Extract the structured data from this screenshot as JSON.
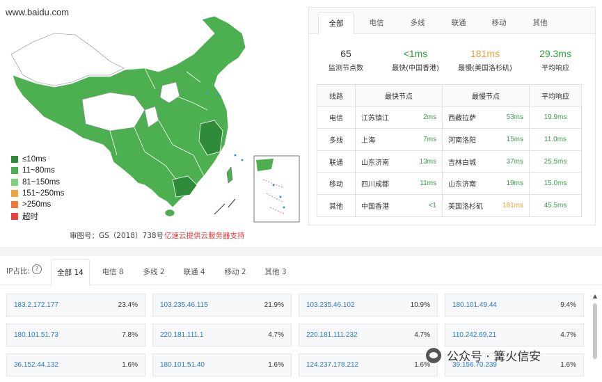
{
  "map": {
    "domain": "www.baidu.com",
    "legend": [
      {
        "label": "≤10ms",
        "color": "#2e8b3a"
      },
      {
        "label": "11~80ms",
        "color": "#4caf50"
      },
      {
        "label": "81~150ms",
        "color": "#7ed07a"
      },
      {
        "label": "151~250ms",
        "color": "#f2a23c"
      },
      {
        "label": ">250ms",
        "color": "#f07a3a"
      },
      {
        "label": "超时",
        "color": "#e84343"
      }
    ],
    "caption": "审图号：GS（2018）738号",
    "credit": "亿速云提供云服务器支持"
  },
  "panel": {
    "tabs": [
      "全部",
      "电信",
      "多线",
      "联通",
      "移动",
      "其他"
    ],
    "active_tab": "全部",
    "stats": [
      {
        "value": "65",
        "label": "监测节点数",
        "color": "#333333"
      },
      {
        "value": "<1ms",
        "label": "最快(中国香港)",
        "color": "#2e9e3e"
      },
      {
        "value": "181ms",
        "label": "最慢(美国洛杉矶)",
        "color": "#f0a030"
      },
      {
        "value": "29.3ms",
        "label": "平均响应",
        "color": "#2e9e3e"
      }
    ],
    "table": {
      "headers": [
        "线路",
        "最快节点",
        "最慢节点",
        "平均响应"
      ],
      "rows": [
        {
          "line": "电信",
          "fast_node": "江苏镇江",
          "fast_ms": "2ms",
          "slow_node": "西藏拉萨",
          "slow_ms": "53ms",
          "avg": "19.9ms"
        },
        {
          "line": "多线",
          "fast_node": "上海",
          "fast_ms": "7ms",
          "slow_node": "河南洛阳",
          "slow_ms": "15ms",
          "avg": "11.0ms"
        },
        {
          "line": "联通",
          "fast_node": "山东济南",
          "fast_ms": "13ms",
          "slow_node": "吉林白城",
          "slow_ms": "37ms",
          "avg": "25.5ms"
        },
        {
          "line": "移动",
          "fast_node": "四川成都",
          "fast_ms": "11ms",
          "slow_node": "山东济南",
          "slow_ms": "19ms",
          "avg": "15.0ms"
        },
        {
          "line": "其他",
          "fast_node": "中国香港",
          "fast_ms": "<1",
          "slow_node": "美国洛杉矶",
          "slow_ms": "181ms",
          "avg": "45.5ms"
        }
      ]
    }
  },
  "ip": {
    "label": "IP占比:",
    "help_icon": "question-circle-icon",
    "tabs": [
      "全部 14",
      "电信 8",
      "多线 2",
      "联通 4",
      "移动 2",
      "其他 3"
    ],
    "active_tab": "全部 14",
    "cards": [
      {
        "ip": "183.2.172.177",
        "pct": "23.4%"
      },
      {
        "ip": "103.235.46.115",
        "pct": "21.9%"
      },
      {
        "ip": "103.235.46.102",
        "pct": "10.9%"
      },
      {
        "ip": "180.101.49.44",
        "pct": "9.4%"
      },
      {
        "ip": "180.101.51.73",
        "pct": "7.8%"
      },
      {
        "ip": "220.181.111.1",
        "pct": "4.7%"
      },
      {
        "ip": "220.181.111.232",
        "pct": "4.7%"
      },
      {
        "ip": "110.242.69.21",
        "pct": "4.7%"
      },
      {
        "ip": "36.152.44.132",
        "pct": "1.6%"
      },
      {
        "ip": "180.101.51.40",
        "pct": "1.6%"
      },
      {
        "ip": "124.237.178.212",
        "pct": "1.6%"
      },
      {
        "ip": "39.156.70.239",
        "pct": "1.6%"
      }
    ]
  },
  "watermark": {
    "text": "公众号 · 篝火信安"
  }
}
